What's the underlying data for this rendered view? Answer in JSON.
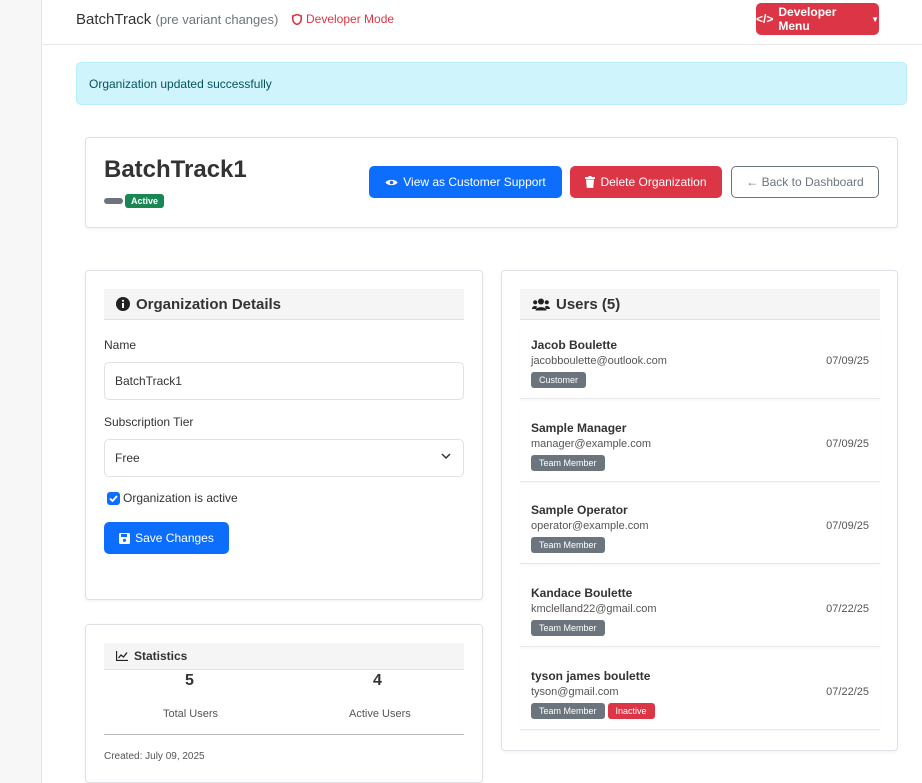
{
  "topbar": {
    "brand": "BatchTrack",
    "brand_sub": "(pre variant changes)",
    "dev_mode": "Developer Mode",
    "dev_menu": "Developer Menu"
  },
  "alert": {
    "message": "Organization updated successfully"
  },
  "org": {
    "title": "BatchTrack1",
    "status_badge": "Active",
    "btn_view_support": "View as Customer Support",
    "btn_delete": "Delete Organization",
    "btn_back": "← Back to Dashboard"
  },
  "details": {
    "heading": "Organization Details",
    "name_label": "Name",
    "name_value": "BatchTrack1",
    "tier_label": "Subscription Tier",
    "tier_value": "Free",
    "active_label": "Organization is active",
    "save_label": "Save Changes"
  },
  "stats": {
    "heading": "Statistics",
    "total_users": "5",
    "total_users_label": "Total Users",
    "active_users": "4",
    "active_users_label": "Active Users",
    "created": "Created: July 09, 2025"
  },
  "users": {
    "heading": "Users (5)",
    "items": [
      {
        "name": "Jacob Boulette",
        "email": "jacobboulette@outlook.com",
        "date": "07/09/25",
        "role": "Customer",
        "status": ""
      },
      {
        "name": "Sample Manager",
        "email": "manager@example.com",
        "date": "07/09/25",
        "role": "Team Member",
        "status": ""
      },
      {
        "name": "Sample Operator",
        "email": "operator@example.com",
        "date": "07/09/25",
        "role": "Team Member",
        "status": ""
      },
      {
        "name": "Kandace Boulette",
        "email": "kmclelland22@gmail.com",
        "date": "07/22/25",
        "role": "Team Member",
        "status": ""
      },
      {
        "name": "tyson james boulette",
        "email": "tyson@gmail.com",
        "date": "07/22/25",
        "role": "Team Member",
        "status": "Inactive"
      }
    ]
  },
  "colors": {
    "primary": "#0d6efd",
    "danger": "#dc3545",
    "success": "#198754",
    "secondary": "#6c757d",
    "info_bg": "#cff4fc"
  }
}
